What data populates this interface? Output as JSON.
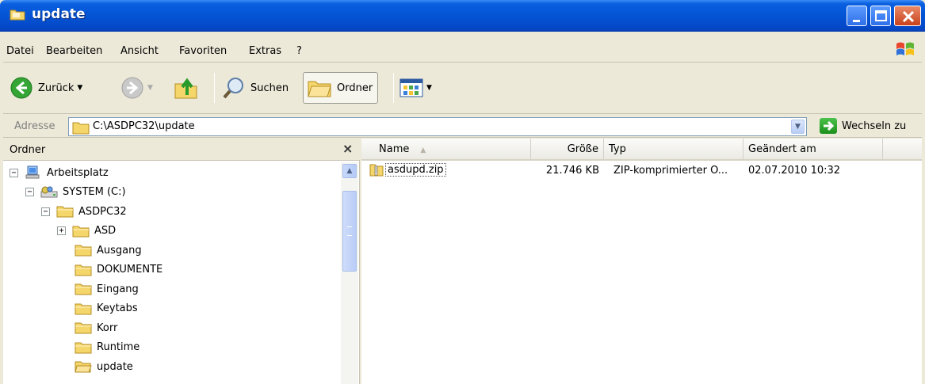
{
  "window": {
    "title": "update"
  },
  "menu": {
    "items": [
      "Datei",
      "Bearbeiten",
      "Ansicht",
      "Favoriten",
      "Extras",
      "?"
    ]
  },
  "toolbar": {
    "back_label": "Zurück",
    "search_label": "Suchen",
    "folders_label": "Ordner"
  },
  "address": {
    "label": "Adresse",
    "value": "C:\\ASDPC32\\update",
    "go_label": "Wechseln zu"
  },
  "folders_pane": {
    "title": "Ordner",
    "close_glyph": "×",
    "tree": [
      {
        "label": "Arbeitsplatz",
        "expander": "−",
        "icon": "my-computer-icon"
      },
      {
        "label": "SYSTEM (C:)",
        "expander": "−",
        "icon": "drive-icon"
      },
      {
        "label": "ASDPC32",
        "expander": "−",
        "icon": "folder-icon"
      },
      {
        "label": "ASD",
        "expander": "+",
        "icon": "folder-icon"
      },
      {
        "label": "Ausgang",
        "expander": "",
        "icon": "folder-icon"
      },
      {
        "label": "DOKUMENTE",
        "expander": "",
        "icon": "folder-icon"
      },
      {
        "label": "Eingang",
        "expander": "",
        "icon": "folder-icon"
      },
      {
        "label": "Keytabs",
        "expander": "",
        "icon": "folder-icon"
      },
      {
        "label": "Korr",
        "expander": "",
        "icon": "folder-icon"
      },
      {
        "label": "Runtime",
        "expander": "",
        "icon": "folder-icon"
      },
      {
        "label": "update",
        "expander": "",
        "icon": "open-folder-icon"
      }
    ]
  },
  "files": {
    "columns": [
      "Name",
      "Größe",
      "Typ",
      "Geändert am"
    ],
    "rows": [
      {
        "name": "asdupd.zip",
        "size": "21.746 KB",
        "type": "ZIP-komprimierter O...",
        "modified": "02.07.2010 10:32"
      }
    ]
  },
  "colors": {
    "titlebar": "#0454d4",
    "folder": "#f5d66b",
    "window_bg": "#ece9d8"
  }
}
